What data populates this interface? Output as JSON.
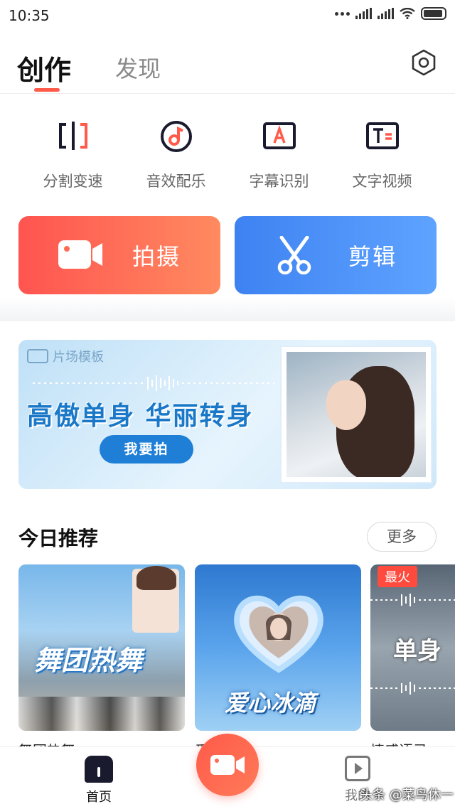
{
  "status_bar": {
    "time": "10:35"
  },
  "header": {
    "active_tab": "创作",
    "inactive_tab": "发现",
    "accent_color": "#ff5a4a"
  },
  "tools": [
    {
      "label": "分割变速",
      "icon": "split-speed-icon"
    },
    {
      "label": "音效配乐",
      "icon": "music-icon"
    },
    {
      "label": "字幕识别",
      "icon": "subtitle-icon"
    },
    {
      "label": "文字视频",
      "icon": "text-video-icon"
    }
  ],
  "actions": {
    "shoot_label": "拍摄",
    "edit_label": "剪辑"
  },
  "banner": {
    "tag": "片场模板",
    "title": "高傲单身 华丽转身",
    "cta": "我要拍"
  },
  "recommend": {
    "title": "今日推荐",
    "more": "更多",
    "cards": [
      {
        "art_text": "舞团热舞",
        "caption": "舞团热舞"
      },
      {
        "art_text": "爱心冰滴",
        "caption": "爱心冰滴"
      },
      {
        "art_text": "单身",
        "badge": "最火",
        "caption": "情感语录"
      }
    ]
  },
  "bottom_nav": {
    "home_label": "首页",
    "mine_label": "我的"
  },
  "watermark": "头条 @菜鸟休一"
}
